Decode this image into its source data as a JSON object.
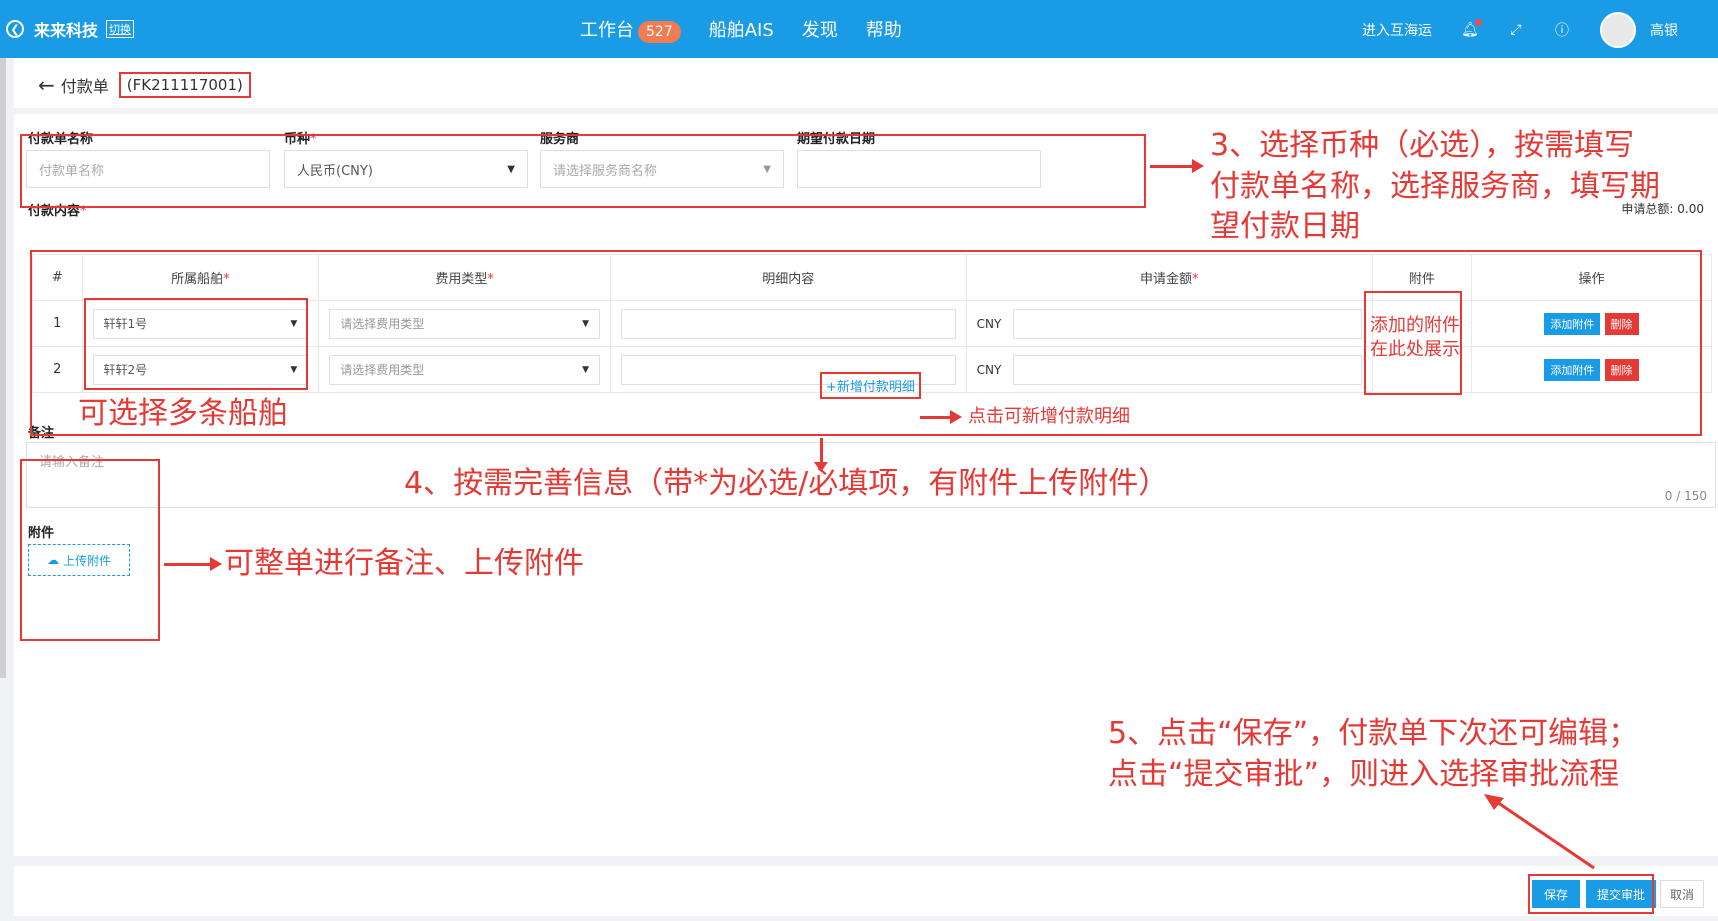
{
  "topbar": {
    "brand": "来来科技",
    "switch_label": "切换",
    "nav": [
      {
        "label": "工作台",
        "badge": "527"
      },
      {
        "label": "船舶AIS"
      },
      {
        "label": "发现"
      },
      {
        "label": "帮助"
      }
    ],
    "enter_label": "进入互海运",
    "user_name": "高银"
  },
  "header": {
    "back_label": "付款单",
    "code": "(FK211117001)"
  },
  "form": {
    "name_label": "付款单名称",
    "name_placeholder": "付款单名称",
    "currency_label": "币种",
    "currency_value": "人民币(CNY)",
    "provider_label": "服务商",
    "provider_placeholder": "请选择服务商名称",
    "date_label": "期望付款日期",
    "content_label": "付款内容",
    "total_label": "申请总额: 0.00",
    "required_mark": "*"
  },
  "table": {
    "headers": [
      "#",
      "所属船舶",
      "费用类型",
      "明细内容",
      "申请金额",
      "附件",
      "操作"
    ],
    "rows": [
      {
        "index": "1",
        "ship": "轩轩1号",
        "fee_placeholder": "请选择费用类型",
        "currency": "CNY",
        "add_attach": "添加附件",
        "delete": "删除"
      },
      {
        "index": "2",
        "ship": "轩轩2号",
        "fee_placeholder": "请选择费用类型",
        "currency": "CNY",
        "add_attach": "添加附件",
        "delete": "删除"
      }
    ],
    "add_row_label": "+新增付款明细"
  },
  "remarks": {
    "label": "备注",
    "placeholder": "请输入备注",
    "counter": "0 / 150",
    "attach_label": "附件",
    "upload_label": "上传附件"
  },
  "footer": {
    "save": "保存",
    "submit": "提交审批",
    "cancel": "取消"
  },
  "annotations": {
    "step3": "3、选择币种（必选），按需填写付款单名称，选择服务商，填写期望付款日期",
    "step3_lines": [
      "3、选择币种（必选），按需填写",
      "付款单名称，选择服务商，填写期",
      "望付款日期"
    ],
    "multi_ship": "可选择多条船舶",
    "attach_show_lines": [
      "添加的附件",
      "在此处展示"
    ],
    "add_detail_hint": "点击可新增付款明细",
    "step4": "4、按需完善信息（带*为必选/必填项，有附件上传附件）",
    "whole_note": "可整单进行备注、上传附件",
    "step5_lines": [
      "5、点击“保存”，付款单下次还可编辑；",
      "点击“提交审批”，则进入选择审批流程"
    ]
  },
  "colors": {
    "primary": "#1a9be6",
    "annotation_red": "#e53935",
    "badge": "#f17c52"
  }
}
